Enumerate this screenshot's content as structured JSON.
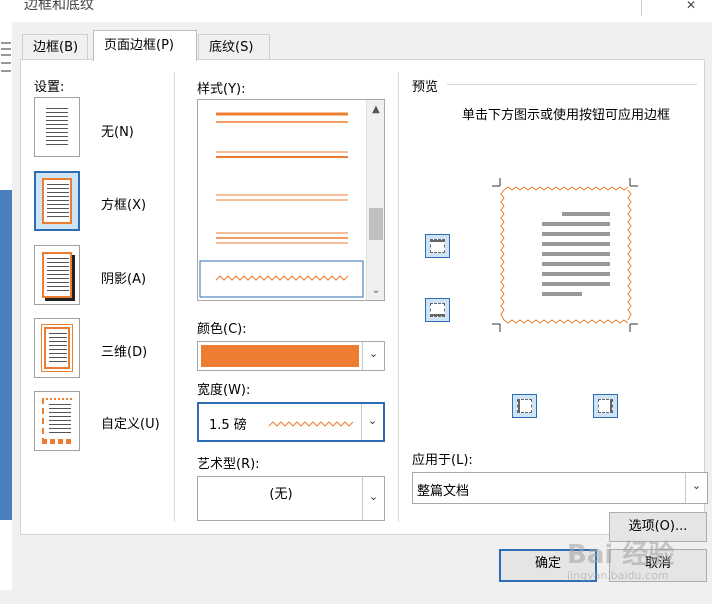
{
  "window": {
    "title": "边框和底纹",
    "close_glyph": "✕"
  },
  "tabs": [
    {
      "label": "边框(B)"
    },
    {
      "label": "页面边框(P)"
    },
    {
      "label": "底纹(S)"
    }
  ],
  "settings": {
    "heading": "设置:",
    "items": [
      {
        "label": "无(N)"
      },
      {
        "label": "方框(X)"
      },
      {
        "label": "阴影(A)"
      },
      {
        "label": "三维(D)"
      },
      {
        "label": "自定义(U)"
      }
    ]
  },
  "style": {
    "heading": "样式(Y):",
    "scroll_up": "▲",
    "scroll_down": "⌄"
  },
  "color": {
    "heading": "颜色(C):",
    "value_hex": "#ed7d31",
    "dropdown": "⌄"
  },
  "width": {
    "heading": "宽度(W):",
    "value": "1.5 磅",
    "dropdown": "⌄"
  },
  "art": {
    "heading": "艺术型(R):",
    "value": "(无)",
    "dropdown": "⌄"
  },
  "preview": {
    "heading": "预览",
    "instruction": "单击下方图示或使用按钮可应用边框"
  },
  "apply_to": {
    "heading": "应用于(L):",
    "value": "整篇文档",
    "dropdown": "⌄"
  },
  "buttons": {
    "options": "选项(O)...",
    "ok": "确定",
    "cancel": "取消"
  },
  "watermark": {
    "text": "Bai 经验",
    "sub": "jingyan.baidu.com"
  },
  "colors": {
    "accent_blue": "#2e6db4",
    "border_orange": "#ed7d31"
  }
}
